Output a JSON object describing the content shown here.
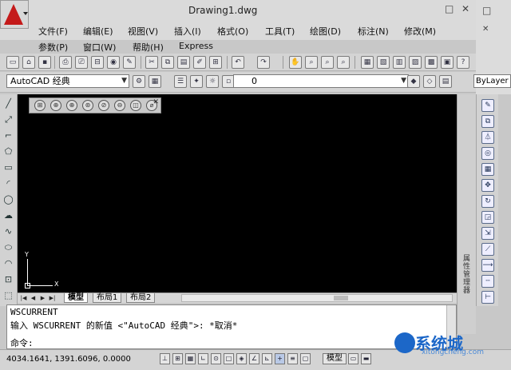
{
  "title": "Drawing1.dwg",
  "window_controls": {
    "minimize": "□",
    "close": "✕",
    "restore": "□"
  },
  "menu": [
    {
      "label": "文件(F)"
    },
    {
      "label": "编辑(E)"
    },
    {
      "label": "视图(V)"
    },
    {
      "label": "插入(I)"
    },
    {
      "label": "格式(O)"
    },
    {
      "label": "工具(T)"
    },
    {
      "label": "绘图(D)"
    },
    {
      "label": "标注(N)"
    },
    {
      "label": "修改(M)"
    },
    {
      "label": "参数(P)"
    },
    {
      "label": "窗口(W)"
    },
    {
      "label": "帮助(H)"
    },
    {
      "label": "Express"
    }
  ],
  "workspace": {
    "value": "AutoCAD 经典",
    "dropdown": "▼"
  },
  "layer": {
    "value": "0",
    "dropdown": "▼"
  },
  "linetype": {
    "value": "ByLayer"
  },
  "ucs": {
    "x": "X",
    "y": "Y"
  },
  "tabs": [
    {
      "label": "模型"
    },
    {
      "label": "布局1"
    },
    {
      "label": "布局2"
    }
  ],
  "command": {
    "line1": "WSCURRENT",
    "line2": "输入 WSCURRENT 的新值 <\"AutoCAD 经典\">: *取消*",
    "prompt": "命令:"
  },
  "status": {
    "coordinates": "4034.1641, 1391.6096, 0.0000",
    "model_label": "模型"
  },
  "side_panel_label": "属性管理器",
  "watermark": {
    "text": "系统城",
    "sub": "xitongcheng.com",
    "faint": "搜狗百科"
  },
  "icons": {
    "app": "autocad-logo-icon",
    "close_floating": "✕"
  }
}
